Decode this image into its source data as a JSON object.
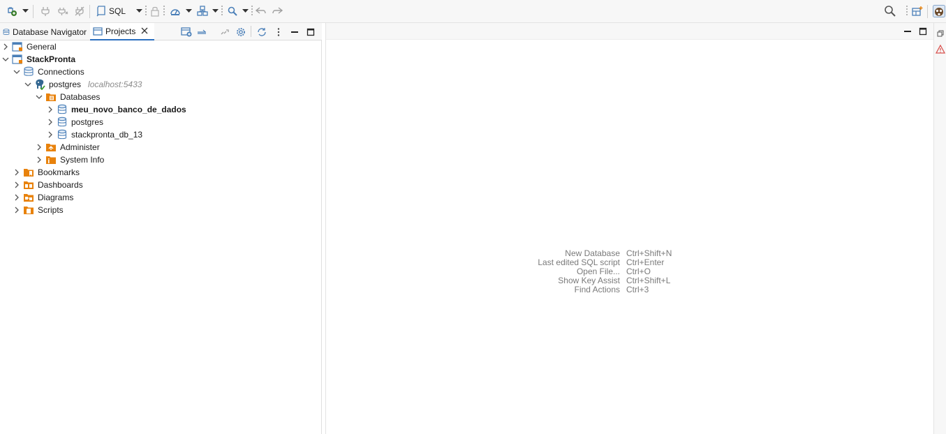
{
  "toolbar": {
    "sql_label": "SQL",
    "icons": [
      "new-connection-icon",
      "connect-icon",
      "disconnect-icon",
      "invalidate-icon",
      "sql-editor-icon",
      "transaction-lock-icon",
      "commit-mode-icon",
      "transaction-log-icon",
      "search-icon",
      "back-icon",
      "forward-icon"
    ]
  },
  "view_tabs": {
    "database_navigator": "Database Navigator",
    "projects": "Projects"
  },
  "tree": {
    "general": "General",
    "project": "StackPronta",
    "connections": "Connections",
    "connection_name": "postgres",
    "connection_host": "localhost:5433",
    "databases": "Databases",
    "db1": "meu_novo_banco_de_dados",
    "db2": "postgres",
    "db3": "stackpronta_db_13",
    "administer": "Administer",
    "system_info": "System Info",
    "bookmarks": "Bookmarks",
    "dashboards": "Dashboards",
    "diagrams": "Diagrams",
    "scripts": "Scripts"
  },
  "editor": {
    "shortcuts": [
      {
        "name": "New Database",
        "key": "Ctrl+Shift+N"
      },
      {
        "name": "Last edited SQL script",
        "key": "Ctrl+Enter"
      },
      {
        "name": "Open File...",
        "key": "Ctrl+O"
      },
      {
        "name": "Show Key Assist",
        "key": "Ctrl+Shift+L"
      },
      {
        "name": "Find Actions",
        "key": "Ctrl+3"
      }
    ]
  },
  "colors": {
    "accent": "#2b6fbf",
    "folder": "#e8820c",
    "db_icon": "#4a7fb8"
  }
}
